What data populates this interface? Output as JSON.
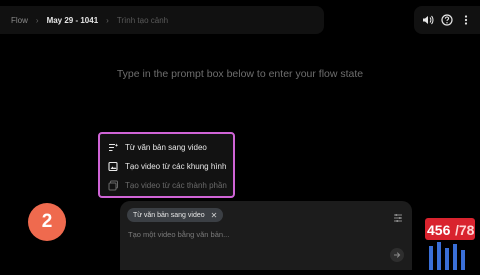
{
  "breadcrumb": {
    "app": "Flow",
    "project": "May 29 - 1041",
    "page": "Trình tạo cảnh"
  },
  "top_icons": [
    "volume-icon",
    "help-icon",
    "more-vert-icon"
  ],
  "hint_text": "Type in the prompt box below to enter your flow state",
  "menu": {
    "items": [
      {
        "label": "Từ văn bản sang video",
        "icon": "text-to-video-icon",
        "enabled": true
      },
      {
        "label": "Tạo video từ các khung hình",
        "icon": "frames-to-video-icon",
        "enabled": true
      },
      {
        "label": "Tạo video từ các thành phần",
        "icon": "ingredients-to-video-icon",
        "enabled": false
      }
    ]
  },
  "step_badge": "2",
  "prompt": {
    "mode_chip": "Từ văn bản sang video",
    "placeholder": "Tạo một video bằng văn bản..."
  },
  "logo_text": "456/78",
  "colors": {
    "highlight_border": "#cf64d6",
    "badge": "#ef6a4e",
    "background": "#000000"
  }
}
